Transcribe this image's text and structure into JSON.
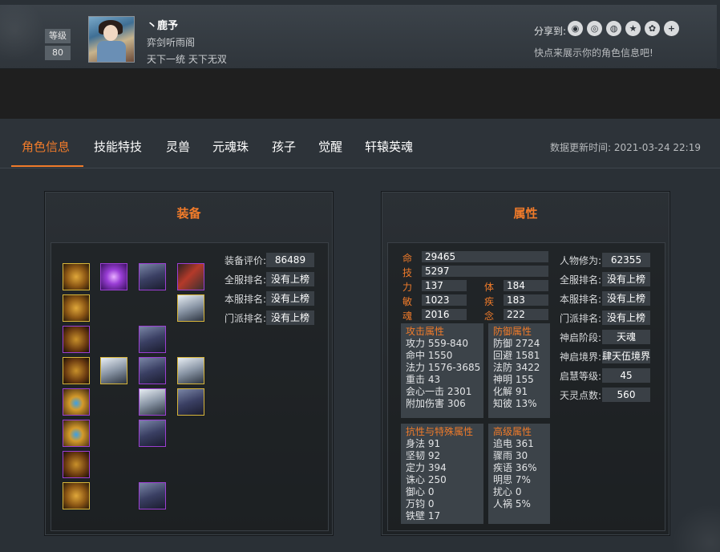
{
  "header": {
    "level_label": "等级",
    "level_value": "80",
    "char_name": "丶鹿予",
    "guild": "弈剑听雨阁",
    "title": "天下一统 天下无双",
    "share_label": "分享到:",
    "share_icons": [
      "wechat-icon",
      "circle-icon",
      "weibo-icon",
      "star-icon",
      "qzone-icon",
      "plus-icon"
    ],
    "share_glyphs": [
      "◉",
      "◎",
      "◍",
      "★",
      "✿",
      "+"
    ],
    "share_hint": "快点来展示你的角色信息吧!"
  },
  "tabs": [
    "角色信息",
    "技能特技",
    "灵兽",
    "元魂珠",
    "孩子",
    "觉醒",
    "轩辕英魂"
  ],
  "update_time": "数据更新时间:  2021-03-24 22:19",
  "equipment": {
    "title": "装备",
    "stats": [
      {
        "label": "装备评价:",
        "value": "86489"
      },
      {
        "label": "全服排名:",
        "value": "没有上榜"
      },
      {
        "label": "本服排名:",
        "value": "没有上榜"
      },
      {
        "label": "门派排名:",
        "value": "没有上榜"
      }
    ]
  },
  "attributes": {
    "title": "属性",
    "main": [
      {
        "key": "命",
        "value": "29465"
      },
      {
        "key": "技",
        "value": "5297"
      }
    ],
    "pairs": [
      {
        "k1": "力",
        "v1": "137",
        "k2": "体",
        "v2": "184"
      },
      {
        "k1": "敏",
        "v1": "1023",
        "k2": "疾",
        "v2": "183"
      },
      {
        "k1": "魂",
        "v1": "2016",
        "k2": "念",
        "v2": "222"
      }
    ],
    "boxes": {
      "attack": {
        "title": "攻击属性",
        "lines": [
          "攻力 559-840",
          "命中 1550",
          "法力 1576-3685",
          "重击 43",
          "会心一击 2301",
          "附加伤害 306"
        ]
      },
      "defense": {
        "title": "防御属性",
        "lines": [
          "防御 2724",
          "回避 1581",
          "法防 3422",
          "神明 155",
          "化解 91",
          "知彼 13%"
        ]
      },
      "resist": {
        "title": "抗性与特殊属性",
        "lines": [
          "身法 91",
          "坚韧 92",
          "定力 394",
          "诛心 250",
          "御心 0",
          "万钧 0",
          "铁壁 17"
        ]
      },
      "advanced": {
        "title": "高级属性",
        "lines": [
          "追电 361",
          "骤雨 30",
          "疾语 36%",
          "明思 7%",
          "扰心 0",
          "人祸 5%"
        ]
      }
    },
    "side": [
      {
        "label": "人物修为:",
        "value": "62355"
      },
      {
        "label": "全服排名:",
        "value": "没有上榜"
      },
      {
        "label": "本服排名:",
        "value": "没有上榜"
      },
      {
        "label": "门派排名:",
        "value": "没有上榜"
      },
      {
        "label": "神启阶段:",
        "value": "天魂"
      },
      {
        "label": "神启境界:",
        "value": "肆天伍境界"
      },
      {
        "label": "启慧等级:",
        "value": "45"
      },
      {
        "label": "天灵点数:",
        "value": "560"
      }
    ]
  }
}
